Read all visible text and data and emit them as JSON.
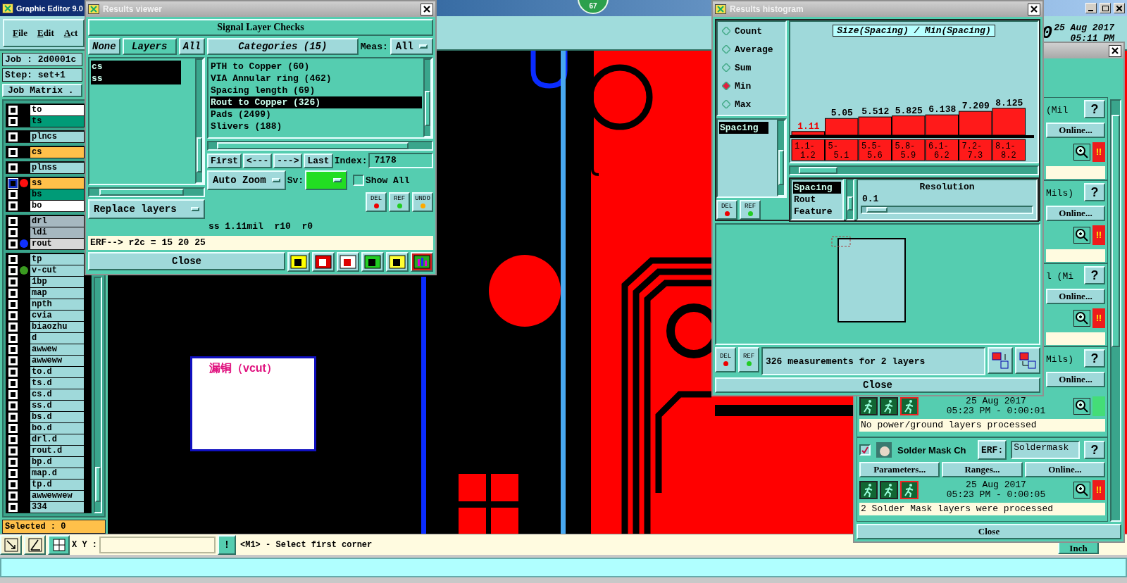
{
  "main_window": {
    "title": "Graphic Editor 9.0",
    "menu": [
      "File",
      "Edit",
      "Act"
    ],
    "job": "Job : 2d0001c",
    "step": "Step: set+1",
    "job_matrix": "Job Matrix .",
    "badge": "67",
    "clock_digit": "0",
    "date": "25 Aug 2017",
    "time": "05:11 PM"
  },
  "layer_groups": [
    [
      {
        "name": "to",
        "color": "#ffffff",
        "selected": false
      },
      {
        "name": "ts",
        "color": "#009b77",
        "selected": false
      }
    ],
    [
      {
        "name": "plncs",
        "color": "#9fd9da",
        "selected": false
      }
    ],
    [
      {
        "name": "cs",
        "color": "#ffc04a",
        "selected": false
      }
    ],
    [
      {
        "name": "plnss",
        "color": "#9fd9da",
        "selected": false
      }
    ],
    [
      {
        "name": "ss",
        "color": "#ffc04a",
        "marker": {
          "color": "#ff1010"
        },
        "selected": true
      },
      {
        "name": "bs",
        "color": "#009b77",
        "selected": false
      },
      {
        "name": "bo",
        "color": "#ffffff",
        "selected": false
      }
    ],
    [
      {
        "name": "drl",
        "color": "#a6b8c0",
        "selected": false
      },
      {
        "name": "ldi",
        "color": "#a6b8c0",
        "selected": false
      },
      {
        "name": "rout",
        "color": "#d8d8d8",
        "marker": {
          "color": "#1030ff"
        },
        "selected": false
      }
    ],
    [
      {
        "name": "tp",
        "color": "#9fd9da",
        "selected": false
      },
      {
        "name": "v-cut",
        "color": "#9fd9da",
        "marker": {
          "color": "#3a9a20"
        },
        "selected": false
      },
      {
        "name": "1bp",
        "color": "#9fd9da",
        "selected": false
      },
      {
        "name": "map",
        "color": "#9fd9da",
        "selected": false
      },
      {
        "name": "npth",
        "color": "#9fd9da",
        "selected": false
      },
      {
        "name": "cvia",
        "color": "#9fd9da",
        "selected": false
      },
      {
        "name": "biaozhu",
        "color": "#9fd9da",
        "selected": false
      },
      {
        "name": "d",
        "color": "#9fd9da",
        "selected": false
      },
      {
        "name": "awwew",
        "color": "#9fd9da",
        "selected": false
      },
      {
        "name": "awweww",
        "color": "#9fd9da",
        "selected": false
      },
      {
        "name": "to.d",
        "color": "#9fd9da",
        "selected": false
      },
      {
        "name": "ts.d",
        "color": "#9fd9da",
        "selected": false
      },
      {
        "name": "cs.d",
        "color": "#9fd9da",
        "selected": false
      },
      {
        "name": "ss.d",
        "color": "#9fd9da",
        "selected": false
      },
      {
        "name": "bs.d",
        "color": "#9fd9da",
        "selected": false
      },
      {
        "name": "bo.d",
        "color": "#9fd9da",
        "selected": false
      },
      {
        "name": "drl.d",
        "color": "#9fd9da",
        "selected": false
      },
      {
        "name": "rout.d",
        "color": "#9fd9da",
        "selected": false
      },
      {
        "name": "bp.d",
        "color": "#9fd9da",
        "selected": false
      },
      {
        "name": "map.d",
        "color": "#9fd9da",
        "selected": false
      },
      {
        "name": "tp.d",
        "color": "#9fd9da",
        "selected": false
      },
      {
        "name": "awwewwew",
        "color": "#9fd9da",
        "selected": false
      },
      {
        "name": "334",
        "color": "#9fd9da",
        "selected": false
      }
    ]
  ],
  "selected_count": "Selected : 0",
  "canvas": {
    "note": "漏铜（vcut）"
  },
  "command_bar": {
    "xy_label": "X Y :",
    "alert": "!",
    "message": "<M1> - Select first corner",
    "units": "Inch"
  },
  "results_viewer": {
    "title": "Results viewer",
    "header": "Signal Layer Checks",
    "layer_buttons": [
      "None",
      "Layers",
      "All"
    ],
    "layers": [
      {
        "name": "cs",
        "selected": true
      },
      {
        "name": "ss",
        "selected": true
      }
    ],
    "layer_action": "Replace layers",
    "categories_button": "Categories (15)",
    "meas_label": "Meas:",
    "meas_value": "All",
    "categories": [
      {
        "label": "PTH to Copper (60)",
        "selected": false
      },
      {
        "label": "VIA Annular ring (462)",
        "selected": false
      },
      {
        "label": "Spacing length (69)",
        "selected": false
      },
      {
        "label": "Rout to Copper (326)",
        "selected": true
      },
      {
        "label": "Pads (2499)",
        "selected": false
      },
      {
        "label": "Slivers (188)",
        "selected": false
      }
    ],
    "nav": [
      "First",
      "<---",
      "--->",
      "Last"
    ],
    "index_label": "Index:",
    "index_value": "7178",
    "zoom_mode": "Auto Zoom",
    "sv_label": "Sv:",
    "show_all": {
      "label": "Show All",
      "checked": false
    },
    "tool_buttons": [
      "DEL",
      "REF",
      "UNDO"
    ],
    "status": "ss 1.11mil  r10  r0",
    "erf": "ERF--> r2c = 15 20 25",
    "close": "Close"
  },
  "histogram": {
    "title": "Results histogram",
    "modes": [
      {
        "label": "Count",
        "selected": false
      },
      {
        "label": "Average",
        "selected": false
      },
      {
        "label": "Sum",
        "selected": false
      },
      {
        "label": "Min",
        "selected": true
      },
      {
        "label": "Max",
        "selected": false
      }
    ],
    "measures": [
      {
        "label": "Spacing",
        "selected": true
      }
    ],
    "tool_buttons": [
      "DEL",
      "REF"
    ],
    "bottom_tool_buttons": [
      "DEL",
      "REF"
    ],
    "chart_data": {
      "type": "bar",
      "title": "Size(Spacing) / Min(Spacing)",
      "categories": [
        "1.1-1.2",
        "5-5.1",
        "5.5-5.6",
        "5.8-5.9",
        "6.1-6.2",
        "7.2-7.3",
        "8.1-8.2"
      ],
      "series": [
        {
          "color": "#ff1a1a",
          "values": [
            1.11,
            5.05,
            5.512,
            5.825,
            6.138,
            7.209,
            8.125
          ]
        }
      ],
      "data_labels": true
    },
    "attributes": [
      {
        "label": "Spacing",
        "selected": true
      },
      {
        "label": "Rout",
        "selected": false
      },
      {
        "label": "Feature",
        "selected": false
      }
    ],
    "resolution_label": "Resolution",
    "resolution_value": "0.1",
    "resolution": {
      "level": 0.05
    },
    "summary": "326 measurements for 2 layers",
    "close": "Close"
  },
  "checks": {
    "blocks": [
      {
        "kind": "partial",
        "caption": "(Mil",
        "help": "?",
        "online": "Online...",
        "status": "!!",
        "color": "#ee1c1c"
      },
      {
        "kind": "partial",
        "caption": "Mils)",
        "help": "?",
        "online": "Online...",
        "status": "!!",
        "color": "#ee1c1c"
      },
      {
        "kind": "partial",
        "caption": "l (Mi",
        "help": "?",
        "online": "Online...",
        "status": "!!",
        "color": "#ee1c1c"
      },
      {
        "kind": "partial_run",
        "caption": "Mils)",
        "help": "?",
        "online": "Online...",
        "date": "25 Aug 2017",
        "time": "05:23 PM - 0:00:01",
        "color": "#44dd77",
        "message": "No power/ground layers processed"
      },
      {
        "kind": "full",
        "checked": true,
        "name": "Solder Mask Ch",
        "erf": "ERF:",
        "erf_value": "Soldermask",
        "help": "?",
        "buttons": [
          "Parameters...",
          "Ranges...",
          "Online..."
        ],
        "date": "25 Aug 2017",
        "time": "05:23 PM - 0:00:05",
        "status": "!!",
        "color": "#ee1c1c",
        "message": "2 Solder Mask layers were processed"
      }
    ],
    "close": "Close"
  }
}
